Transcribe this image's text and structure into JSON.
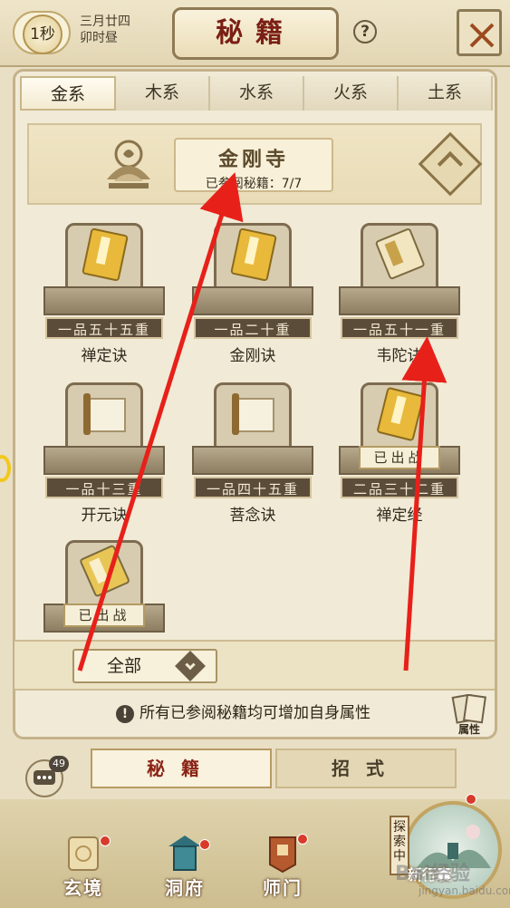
{
  "header": {
    "timer": "1秒",
    "lunar_date": "三月廿四",
    "lunar_time": "卯时昼",
    "title": "秘籍",
    "help": "?"
  },
  "tabs": [
    "金系",
    "木系",
    "水系",
    "火系",
    "土系"
  ],
  "sect": {
    "name": "金刚寺",
    "progress": "已参阅秘籍：7/7"
  },
  "books": [
    {
      "rank": "一品五十五重",
      "name": "禅定诀",
      "status": ""
    },
    {
      "rank": "一品二十重",
      "name": "金刚诀",
      "status": ""
    },
    {
      "rank": "一品五十一重",
      "name": "韦陀诀",
      "status": ""
    },
    {
      "rank": "一品十三重",
      "name": "开元诀",
      "status": ""
    },
    {
      "rank": "一品四十五重",
      "name": "菩念诀",
      "status": ""
    },
    {
      "rank": "二品三十二重",
      "name": "禅定经",
      "status": "已出战"
    },
    {
      "rank": "",
      "name": "",
      "status": "已出战"
    }
  ],
  "filter": {
    "label": "全部"
  },
  "info": "所有已参阅秘籍均可增加自身属性",
  "attribute_button": "属性",
  "chat_count": "49",
  "subtabs": {
    "active": "秘籍",
    "inactive": "招式"
  },
  "bottom_nav": [
    "玄境",
    "洞府",
    "师门"
  ],
  "explore": {
    "tag": "探索中",
    "button": "新行囊"
  },
  "watermark": {
    "main": "Bai经验",
    "sub": "jingyan.baidu.com"
  },
  "colors": {
    "accent_red": "#7a1f14",
    "arrow_red": "#e8201a",
    "badge_dot": "#d83a2a"
  }
}
